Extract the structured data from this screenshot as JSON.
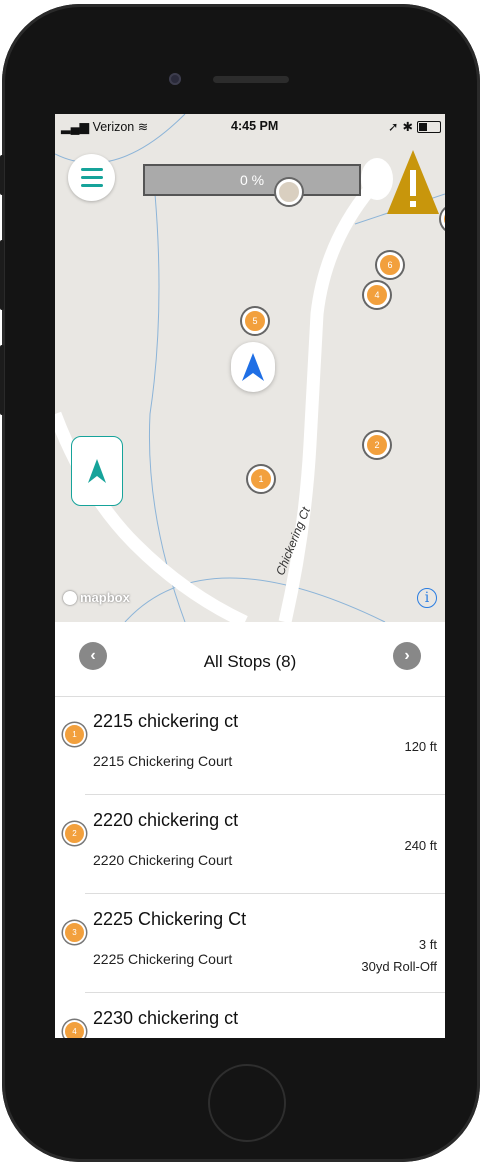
{
  "status_bar": {
    "carrier": "Verizon",
    "time": "4:45 PM"
  },
  "progress": {
    "label": "0 %",
    "value": 0
  },
  "map": {
    "road_name": "Chickering Ct",
    "attribution": "mapbox",
    "markers": [
      {
        "label": "1"
      },
      {
        "label": "2"
      },
      {
        "label": "4"
      },
      {
        "label": "5"
      },
      {
        "label": "6"
      }
    ]
  },
  "list": {
    "title": "All Stops (8)",
    "prev_icon": "chevron-left-icon",
    "next_icon": "chevron-right-icon",
    "stops": [
      {
        "number": "1",
        "name": "2215 chickering ct",
        "address": "2215 Chickering Court",
        "distance": "120 ft",
        "extra": ""
      },
      {
        "number": "2",
        "name": "2220 chickering ct",
        "address": "2220 Chickering Court",
        "distance": "240 ft",
        "extra": ""
      },
      {
        "number": "3",
        "name": "2225 Chickering Ct",
        "address": "2225 Chickering Court",
        "distance": "3 ft",
        "extra": "30yd Roll-Off"
      },
      {
        "number": "4",
        "name": "2230 chickering ct",
        "address": "",
        "distance": "",
        "extra": ""
      }
    ]
  },
  "colors": {
    "accent": "#16a39a",
    "marker": "#f2a03d",
    "warning": "#c8960c",
    "nav_blue": "#1f6fe5"
  }
}
